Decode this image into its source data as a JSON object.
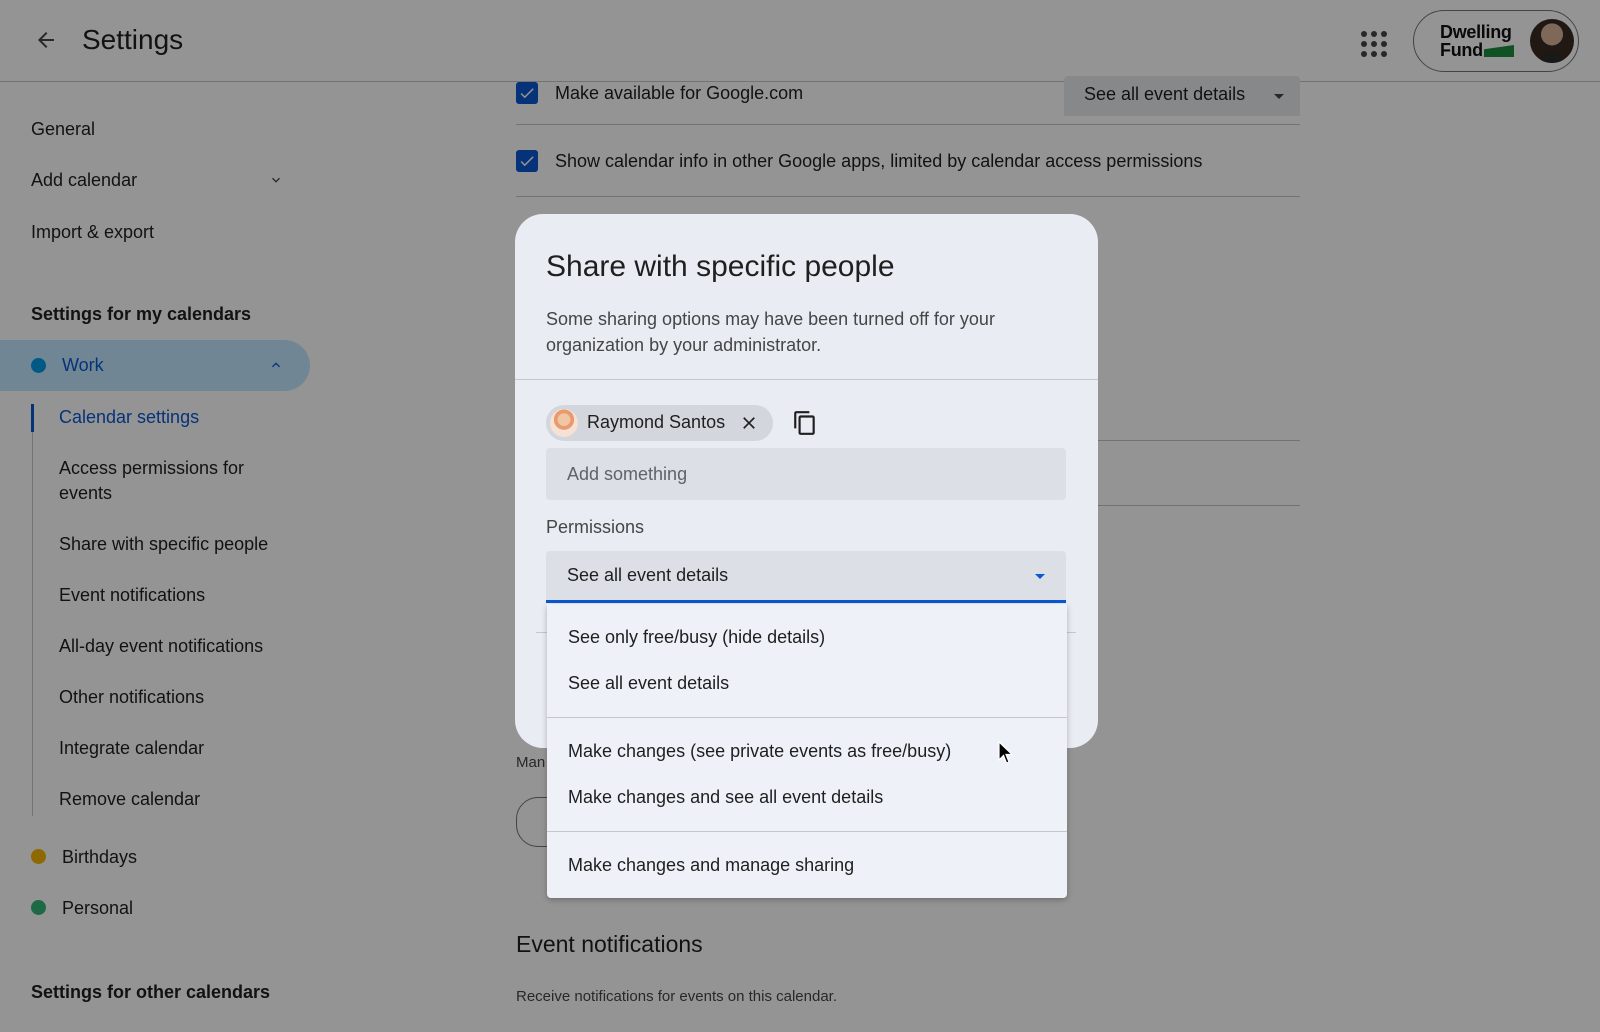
{
  "header": {
    "title": "Settings",
    "brand_line1": "Dwelling",
    "brand_line2": "Fund"
  },
  "sidebar": {
    "general": "General",
    "add_calendar": "Add calendar",
    "import_export": "Import & export",
    "my_calendars_heading": "Settings for my calendars",
    "work": "Work",
    "work_color": "#039be5",
    "work_subitems": [
      "Calendar settings",
      "Access permissions for events",
      "Share with specific people",
      "Event notifications",
      "All-day event notifications",
      "Other notifications",
      "Integrate calendar",
      "Remove calendar"
    ],
    "birthdays": "Birthdays",
    "birthdays_color": "#f4b400",
    "personal": "Personal",
    "personal_color": "#33b679",
    "other_calendars_heading": "Settings for other calendars"
  },
  "main": {
    "make_available": "Make available for Google.com",
    "make_available_select": "See all event details",
    "show_calendar_info": "Show calendar info in other Google apps, limited by calendar access permissions",
    "man_fragment": "Man",
    "event_notifications_heading": "Event notifications",
    "event_notifications_desc": "Receive notifications for events on this calendar."
  },
  "dialog": {
    "title": "Share with specific people",
    "description": "Some sharing options may have been turned off for your organization by your administrator.",
    "chip_name": "Raymond Santos",
    "add_placeholder": "Add something",
    "permissions_label": "Permissions",
    "permissions_value": "See all event details",
    "permission_options": [
      "See only free/busy (hide details)",
      "See all event details",
      "Make changes (see private events as free/busy)",
      "Make changes and see all event details",
      "Make changes and manage sharing"
    ]
  },
  "colors": {
    "accent": "#0b57d0",
    "active_nav_bg": "#c2e7ff"
  }
}
